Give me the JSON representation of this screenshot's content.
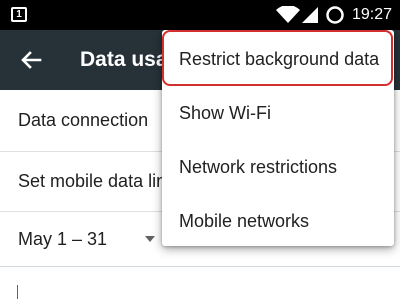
{
  "status_bar": {
    "notification_badge": "1",
    "time": "19:27",
    "icons": [
      "notification-icon",
      "wifi-icon",
      "signal-icon",
      "battery-saver-icon"
    ]
  },
  "app_bar": {
    "title": "Data usa",
    "back_icon": "arrow-left-icon"
  },
  "rows": {
    "data_connection": "Data connection",
    "set_mobile_limit": "Set mobile data lin",
    "cycle": "May 1 – 31"
  },
  "overflow_menu": {
    "items": [
      "Restrict background data",
      "Show Wi-Fi",
      "Network restrictions",
      "Mobile networks"
    ],
    "highlighted_index": 0
  },
  "colors": {
    "app_bar": "#263238",
    "status_bar": "#000000",
    "highlight": "#d32f2f"
  }
}
